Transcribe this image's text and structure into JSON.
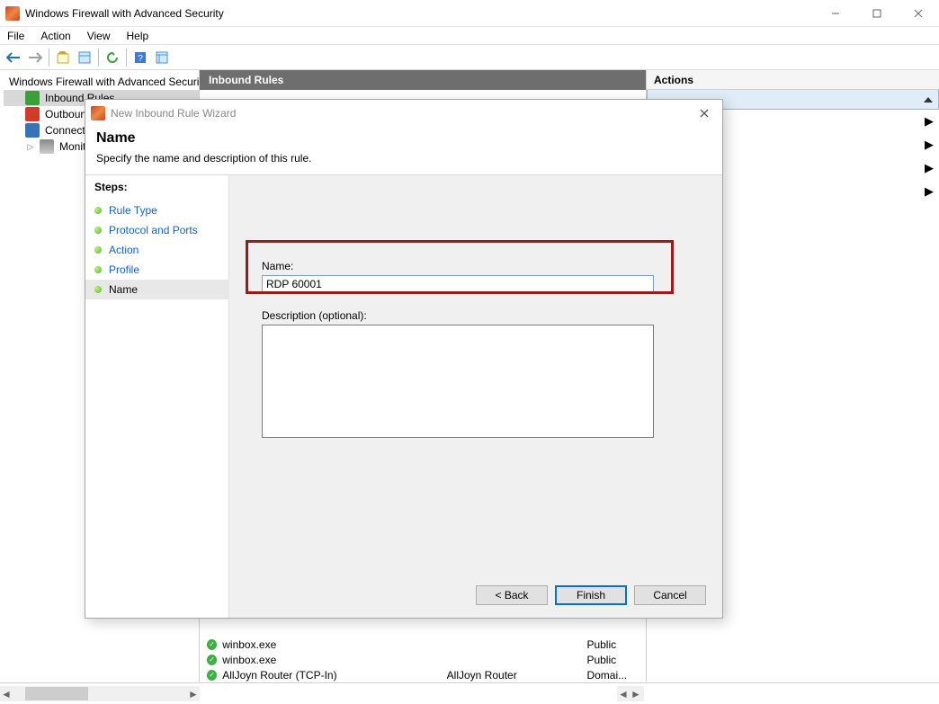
{
  "window": {
    "title": "Windows Firewall with Advanced Security"
  },
  "menubar": [
    "File",
    "Action",
    "View",
    "Help"
  ],
  "tree": {
    "root": "Windows Firewall with Advanced Security",
    "items": [
      "Inbound Rules",
      "Outbound Rules",
      "Connection Security Rules",
      "Monitoring"
    ]
  },
  "mid": {
    "header": "Inbound Rules",
    "visible_rules": [
      {
        "name": "winbox.exe",
        "group": "",
        "profile": "Public"
      },
      {
        "name": "winbox.exe",
        "group": "",
        "profile": "Public"
      },
      {
        "name": "AllJoyn Router (TCP-In)",
        "group": "AllJoyn Router",
        "profile": "Domai..."
      }
    ]
  },
  "actions": {
    "header": "Actions"
  },
  "dialog": {
    "title": "New Inbound Rule Wizard",
    "heading": "Name",
    "subheading": "Specify the name and description of this rule.",
    "steps_label": "Steps:",
    "steps": [
      "Rule Type",
      "Protocol and Ports",
      "Action",
      "Profile",
      "Name"
    ],
    "active_step": "Name",
    "name_label": "Name:",
    "name_value": "RDP 60001",
    "desc_label": "Description (optional):",
    "desc_value": "",
    "btn_back": "< Back",
    "btn_finish": "Finish",
    "btn_cancel": "Cancel"
  }
}
